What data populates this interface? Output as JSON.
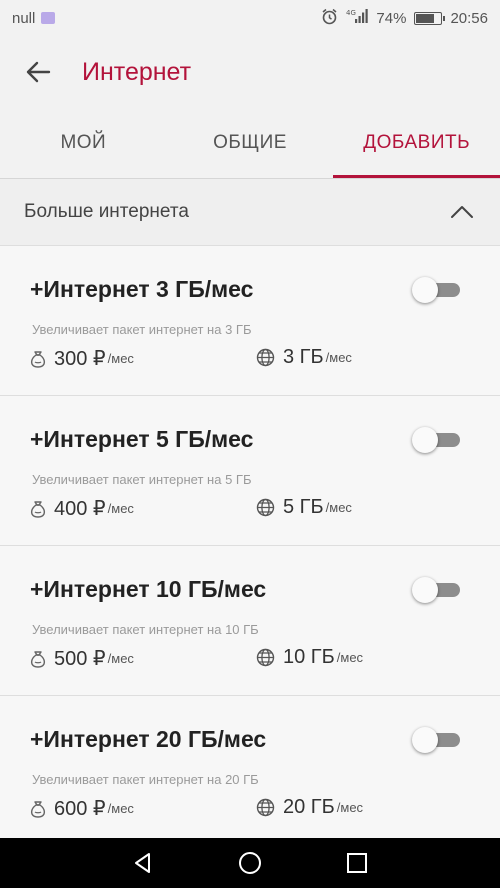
{
  "status_bar": {
    "carrier": "null",
    "battery": "74%",
    "battery_level": 0.74,
    "time": "20:56"
  },
  "header": {
    "title": "Интернет"
  },
  "tabs": [
    {
      "label": "МОЙ",
      "active": false
    },
    {
      "label": "ОБЩИЕ",
      "active": false
    },
    {
      "label": "ДОБАВИТЬ",
      "active": true
    }
  ],
  "section": {
    "title": "Больше интернета"
  },
  "cards": [
    {
      "title": "+Интернет 3 ГБ/мес",
      "desc": "Увеличивает пакет интернет на 3 ГБ",
      "price": "300 ₽",
      "price_unit": "/мес",
      "volume": "3 ГБ",
      "volume_unit": "/мес",
      "enabled": false
    },
    {
      "title": "+Интернет 5 ГБ/мес",
      "desc": "Увеличивает пакет интернет на 5 ГБ",
      "price": "400 ₽",
      "price_unit": "/мес",
      "volume": "5 ГБ",
      "volume_unit": "/мес",
      "enabled": false
    },
    {
      "title": "+Интернет 10 ГБ/мес",
      "desc": "Увеличивает пакет интернет на 10 ГБ",
      "price": "500 ₽",
      "price_unit": "/мес",
      "volume": "10 ГБ",
      "volume_unit": "/мес",
      "enabled": false
    },
    {
      "title": "+Интернет 20 ГБ/мес",
      "desc": "Увеличивает пакет интернет на 20 ГБ",
      "price": "600 ₽",
      "price_unit": "/мес",
      "volume": "20 ГБ",
      "volume_unit": "/мес",
      "enabled": false
    }
  ],
  "colors": {
    "accent": "#b3133b",
    "background": "#f2f2f2",
    "card": "#f7f7f7"
  },
  "icons": {
    "back": "arrow-left-icon",
    "collapse": "chevron-up-icon",
    "price": "money-bag-icon",
    "volume": "globe-icon",
    "nav_back": "triangle-back-icon",
    "nav_home": "circle-home-icon",
    "nav_recent": "square-recent-icon"
  }
}
